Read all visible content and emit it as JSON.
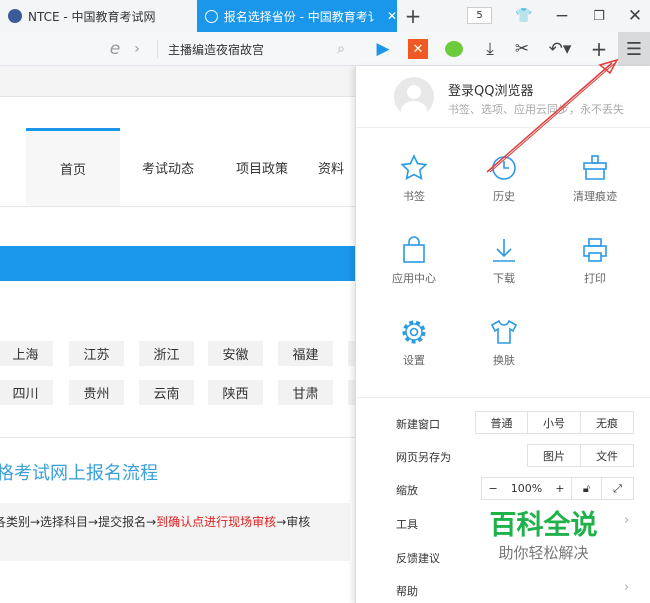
{
  "tabs": [
    {
      "label": "NTCE - 中国教育考试网",
      "icon": "ntce-logo-icon"
    },
    {
      "label": "报名选择省份 - 中国教育考讠",
      "icon": "globe-icon"
    }
  ],
  "tab_count": "5",
  "address": {
    "search_text": "主播编造夜宿故宫"
  },
  "page": {
    "nav": [
      "首页",
      "考试动态",
      "项目政策",
      "资料"
    ],
    "provinces_row1": [
      "上海",
      "江苏",
      "浙江",
      "安徽",
      "福建"
    ],
    "provinces_row2": [
      "四川",
      "贵州",
      "云南",
      "陕西",
      "甘肃"
    ],
    "section_title": "格考试网上报名流程",
    "flow_before": "各类别→选择科目→提交报名→",
    "flow_highlight": "到确认点进行现场审核",
    "flow_after": "→审核",
    "colors": {
      "accent": "#1a96ea",
      "highlight": "#e02020",
      "title": "#3aa0d8"
    }
  },
  "menu": {
    "login_title": "登录QQ浏览器",
    "login_sub": "书签、选项、应用云同步，永不丢失",
    "grid": [
      {
        "label": "书签",
        "icon": "star-icon"
      },
      {
        "label": "历史",
        "icon": "clock-icon"
      },
      {
        "label": "清理痕迹",
        "icon": "broom-icon"
      },
      {
        "label": "应用中心",
        "icon": "bag-icon"
      },
      {
        "label": "下载",
        "icon": "download-icon"
      },
      {
        "label": "打印",
        "icon": "printer-icon"
      },
      {
        "label": "设置",
        "icon": "gear-icon"
      },
      {
        "label": "换肤",
        "icon": "shirt-icon"
      }
    ],
    "new_window": {
      "label": "新建窗口",
      "options": [
        "普通",
        "小号",
        "无痕"
      ]
    },
    "save_as": {
      "label": "网页另存为",
      "options": [
        "图片",
        "文件"
      ]
    },
    "zoom": {
      "label": "缩放",
      "minus": "−",
      "value": "100%",
      "plus": "+"
    },
    "tools": "工具",
    "feedback": "反馈建议",
    "help": "帮助"
  },
  "watermark": {
    "title": "百科全说",
    "subtitle": "助你轻松解决"
  }
}
